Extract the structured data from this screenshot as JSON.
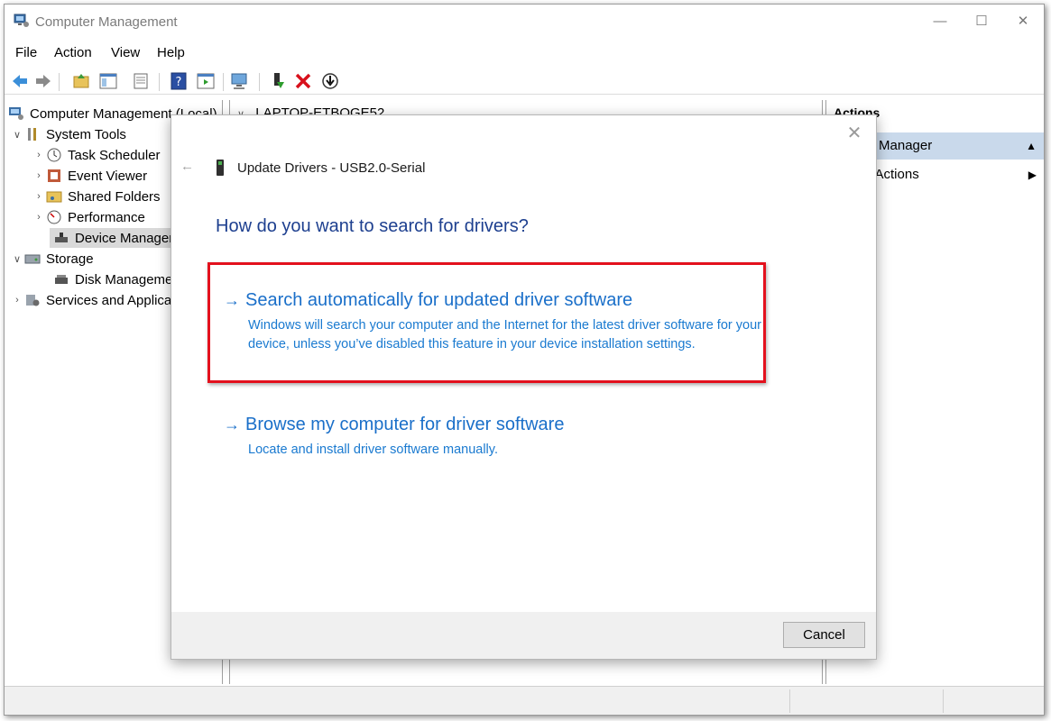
{
  "window": {
    "title": "Computer Management"
  },
  "menu": [
    "File",
    "Action",
    "View",
    "Help"
  ],
  "tree": {
    "root": "Computer Management (Local)",
    "system_tools": "System Tools",
    "task_scheduler": "Task Scheduler",
    "event_viewer": "Event Viewer",
    "shared_folders": "Shared Folders",
    "performance": "Performance",
    "device_manager": "Device Manager",
    "storage": "Storage",
    "disk_management": "Disk Management",
    "services": "Services and Applications"
  },
  "center": {
    "computer_name": "LAPTOP-ETBOGE52"
  },
  "actions": {
    "header": "Actions",
    "item1": "Device Manager",
    "item2": "More Actions"
  },
  "dialog": {
    "title": "Update Drivers - USB2.0-Serial",
    "question": "How do you want to search for drivers?",
    "option1_title": "Search automatically for updated driver software",
    "option1_desc": "Windows will search your computer and the Internet for the latest driver software for your device, unless you’ve disabled this feature in your device installation settings.",
    "option2_title": "Browse my computer for driver software",
    "option2_desc": "Locate and install driver software manually.",
    "cancel": "Cancel"
  },
  "colors": {
    "highlight": "#e3111d",
    "link": "#1a6fc9",
    "heading": "#1d3f8f"
  }
}
